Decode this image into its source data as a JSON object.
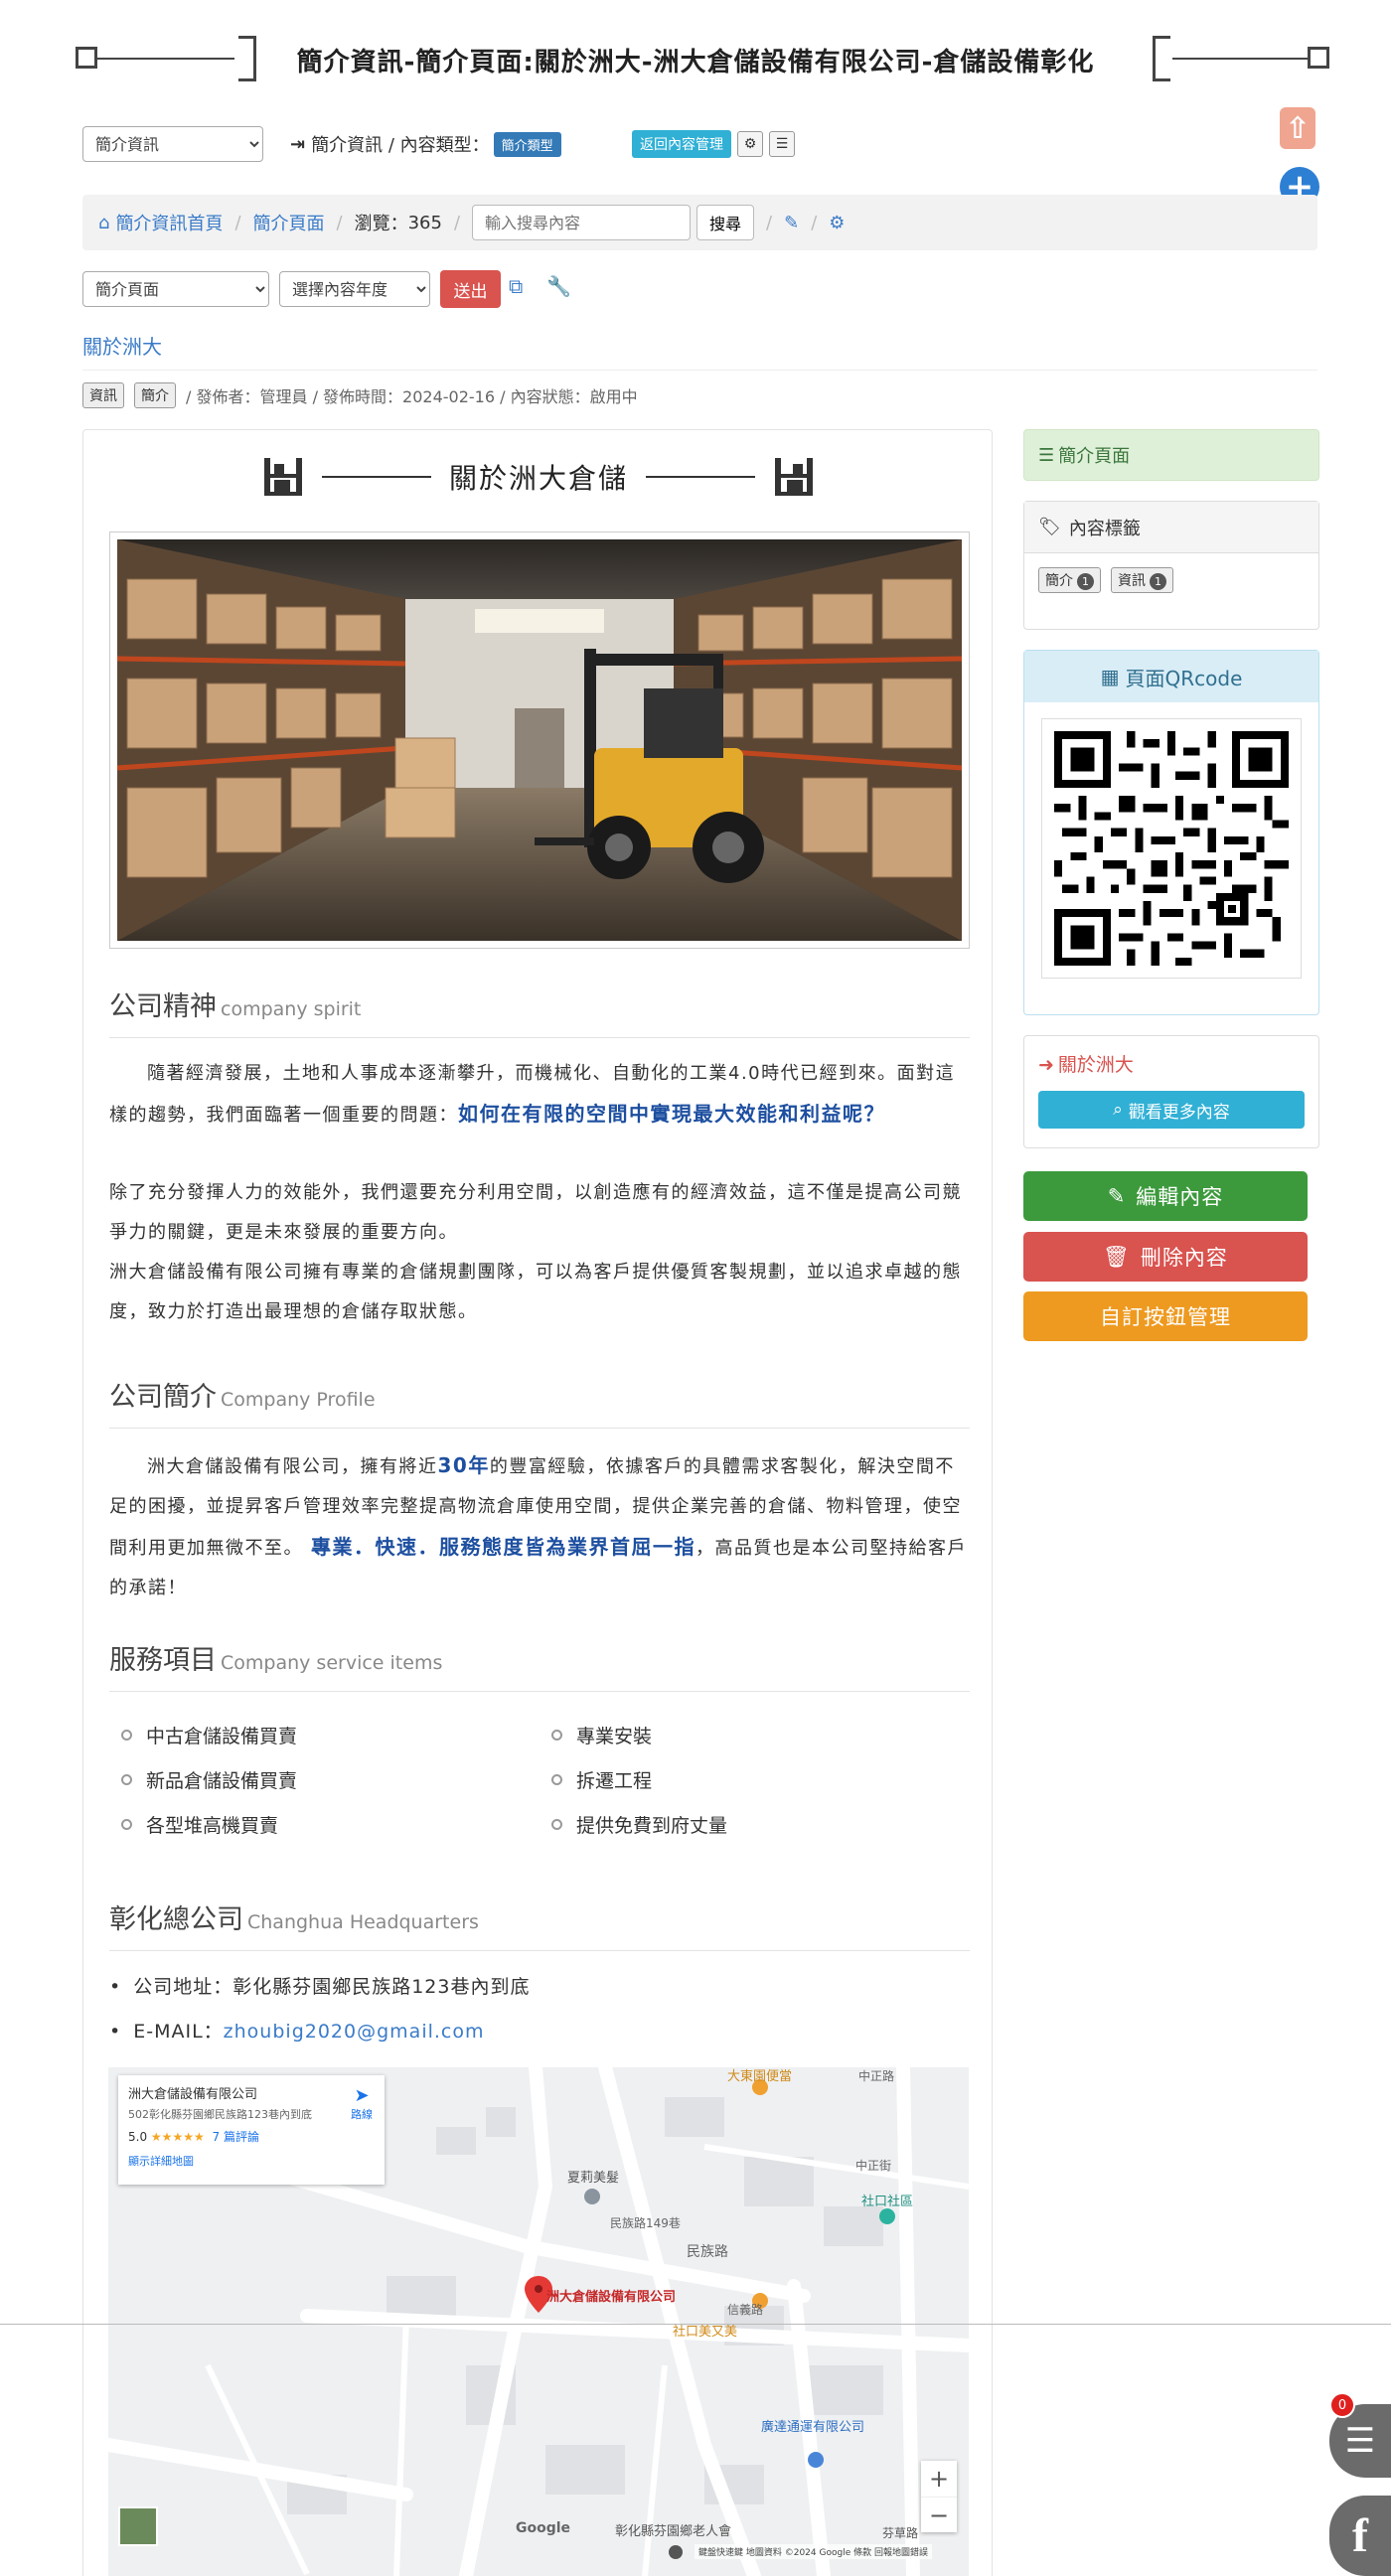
{
  "title": "簡介資訊-簡介頁面:關於洲大-洲大倉儲設備有限公司-倉儲設備彰化",
  "toolbar": {
    "category_select": "簡介資訊",
    "path_text": "簡介資訊 / 內容類型：",
    "type_label": "簡介類型",
    "back_button": "返回內容管理"
  },
  "breadcrumb": {
    "home": "簡介資訊首頁",
    "page": "簡介頁面",
    "views_label": "瀏覽：",
    "views": "365",
    "search_placeholder": "輸入搜尋內容",
    "search_button": "搜尋"
  },
  "filters": {
    "page_select": "簡介頁面",
    "year_select": "選擇內容年度",
    "submit_button": "送出"
  },
  "article": {
    "link_title": "關於洲大",
    "tags": [
      "資訊",
      "簡介"
    ],
    "meta": "/ 發佈者：管理員 / 發佈時間：2024-02-16 / 內容狀態：啟用中",
    "heading": "關於洲大倉儲"
  },
  "spirit": {
    "title": "公司精神",
    "subtitle": "company spirit",
    "p1a": "隨著經濟發展，土地和人事成本逐漸攀升，而機械化、自動化的工業4.0時代已經到來。面對這樣的趨勢，我們面臨著一個重要的問題：",
    "p1b": "如何在有限的空間中實現最大效能和利益呢？",
    "p2": "除了充分發揮人力的效能外，我們還要充分利用空間，以創造應有的經濟效益，這不僅是提高公司競爭力的關鍵，更是未來發展的重要方向。",
    "p3": "洲大倉儲設備有限公司擁有專業的倉儲規劃團隊，可以為客戶提供優質客製規劃，並以追求卓越的態度，致力於打造出最理想的倉儲存取狀態。"
  },
  "profile": {
    "title": "公司簡介",
    "subtitle": "Company Profile",
    "t1": "洲大倉儲設備有限公司，擁有將近",
    "t2": "30年",
    "t3": "的豐富經驗，依據客戶的具體需求客製化，解決空間不足的困擾，並提昇客戶管理效率完整提高物流倉庫使用空間，提供企業完善的倉儲、物料管理，使空間利用更加無微不至。",
    "t4": "專業．快速．服務態度皆為業界首屈一指",
    "t5": "，高品質也是本公司堅持給客戶的承諾！"
  },
  "services": {
    "title": "服務項目",
    "subtitle": "Company service items",
    "left": [
      "中古倉儲設備買賣",
      "新品倉儲設備買賣",
      "各型堆高機買賣"
    ],
    "right": [
      "專業安裝",
      "拆遷工程",
      "提供免費到府丈量"
    ]
  },
  "hq": {
    "title": "彰化總公司",
    "subtitle": "Changhua Headquarters",
    "address": "公司地址：彰化縣芬園鄉民族路123巷內到底",
    "email_label": "E-MAIL：",
    "email": "zhoubig2020@gmail.com"
  },
  "map": {
    "card_title": "洲大倉儲設備有限公司",
    "card_address": "502彰化縣芬園鄉民族路123巷內到底",
    "rating": "5.0",
    "stars": "★★★★★",
    "reviews": "7 篇評論",
    "larger_map": "顯示詳細地圖",
    "directions": "路線",
    "pin_label": "洲大倉儲設備有限公司",
    "places": [
      "大東園便當",
      "夏莉美髮",
      "社口社區",
      "社口美又美",
      "廣達通運有限公司",
      "彰化縣芬園鄉老人會",
      "芬草路"
    ],
    "roads": [
      "民族路149巷",
      "民族路",
      "信義路",
      "中正街",
      "中正路"
    ],
    "footer": "鍵盤快速鍵  地圖資料 ©2024 Google  條款  回報地圖錯誤",
    "google": "Google"
  },
  "sidebar": {
    "page_header": "簡介頁面",
    "tags_header": "內容標籤",
    "tags": [
      {
        "name": "簡介",
        "count": "1"
      },
      {
        "name": "資訊",
        "count": "1"
      }
    ],
    "qr_header": "頁面QRcode",
    "related_link": "關於洲大",
    "more_button": "觀看更多內容",
    "edit_button": "編輯內容",
    "delete_button": "刪除內容",
    "custom_button": "自訂按鈕管理"
  },
  "float": {
    "chat_count": "0"
  },
  "colors": {
    "link": "#3a7bc8",
    "danger": "#d9534f",
    "success": "#3c9a3c",
    "warning": "#ee9a20",
    "info_header": "#d9edf7",
    "success_header": "#dff0d8"
  }
}
